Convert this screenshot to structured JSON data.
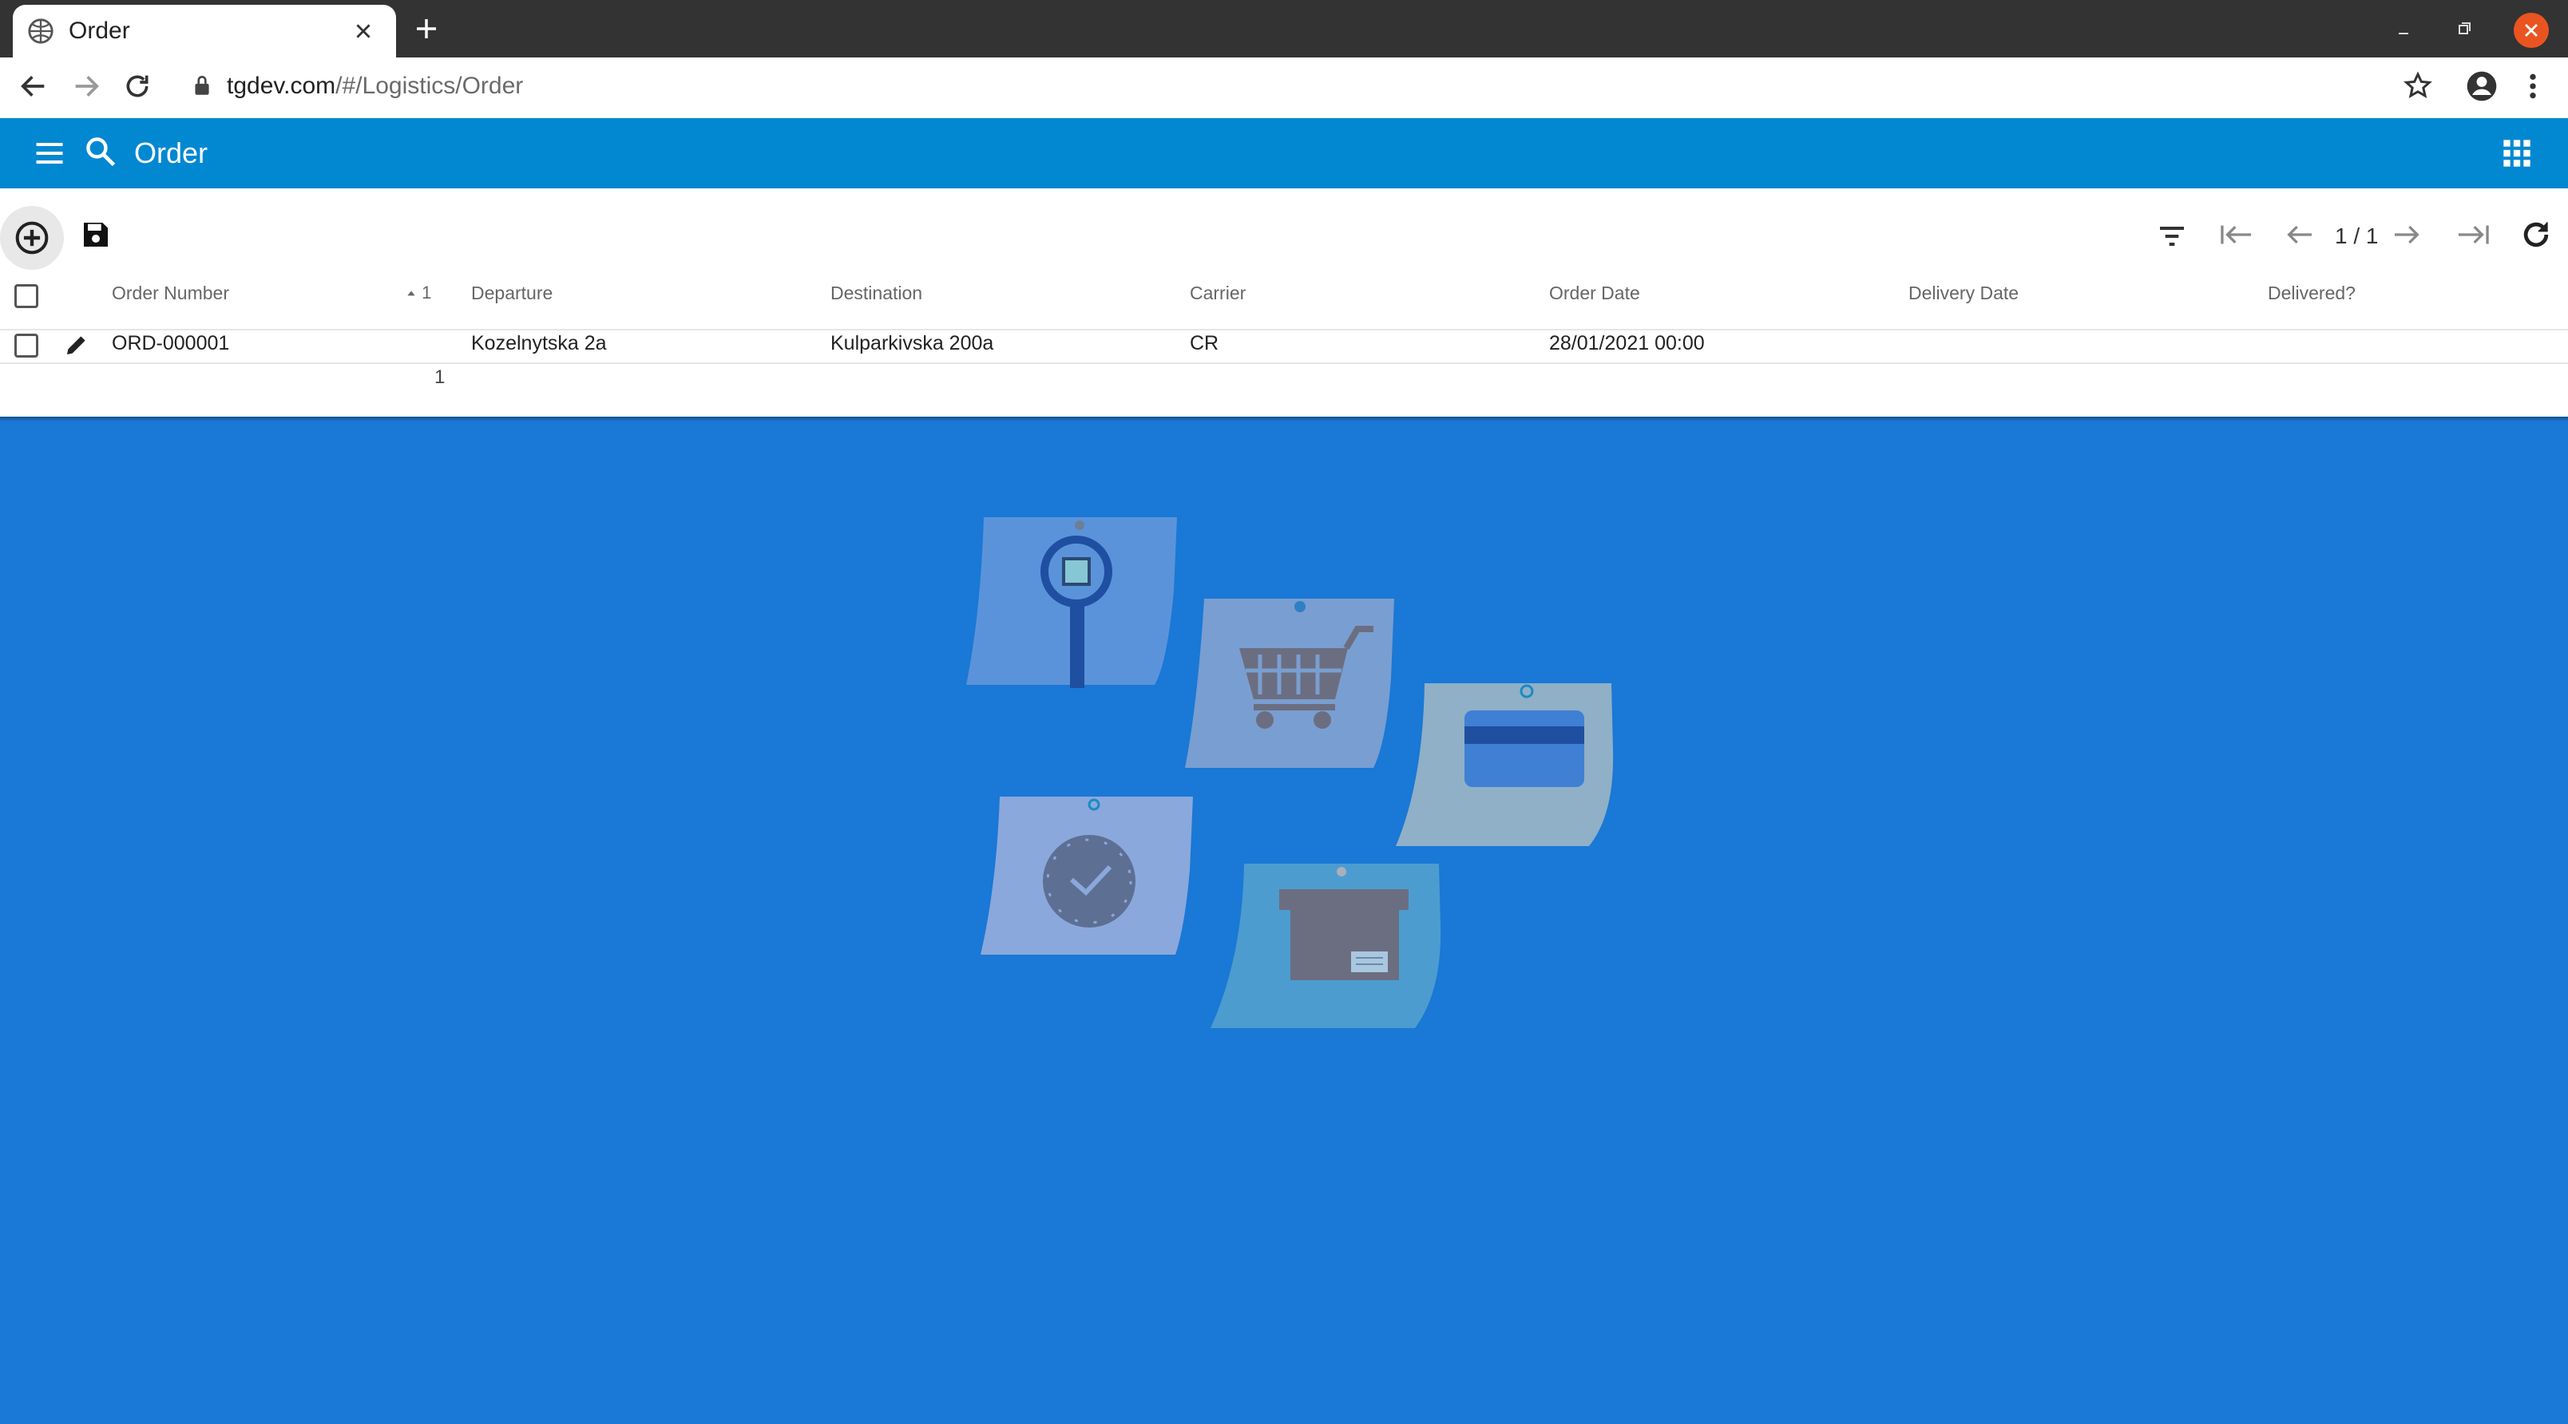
{
  "browser": {
    "tab_title": "Order",
    "url_host": "tgdev.com",
    "url_path": "/#/Logistics/Order"
  },
  "appbar": {
    "title": "Order"
  },
  "grid": {
    "columns": [
      "Order Number",
      "Departure",
      "Destination",
      "Carrier",
      "Order Date",
      "Delivery Date",
      "Delivered?"
    ],
    "sort_indicator": "1",
    "rows": [
      {
        "order_number": "ORD-000001",
        "departure": "Kozelnytska 2a",
        "destination": "Kulparkivska 200a",
        "carrier": "CR",
        "order_date": "28/01/2021 00:00",
        "delivery_date": "",
        "delivered": ""
      }
    ],
    "row_count": "1"
  },
  "pager": {
    "indicator": "1 / 1"
  },
  "colors": {
    "appbar": "#0288d1",
    "background": "#1a78d6",
    "window_close": "#e95420"
  },
  "icons": [
    "globe-icon",
    "close-icon",
    "plus-icon",
    "back-arrow-icon",
    "forward-arrow-icon",
    "reload-icon",
    "lock-icon",
    "star-icon",
    "account-icon",
    "kebab-menu-icon",
    "hamburger-menu-icon",
    "search-icon",
    "apps-grid-icon",
    "add-circle-icon",
    "save-icon",
    "filter-icon",
    "first-page-icon",
    "prev-page-icon",
    "next-page-icon",
    "last-page-icon",
    "refresh-icon",
    "edit-pencil-icon"
  ]
}
